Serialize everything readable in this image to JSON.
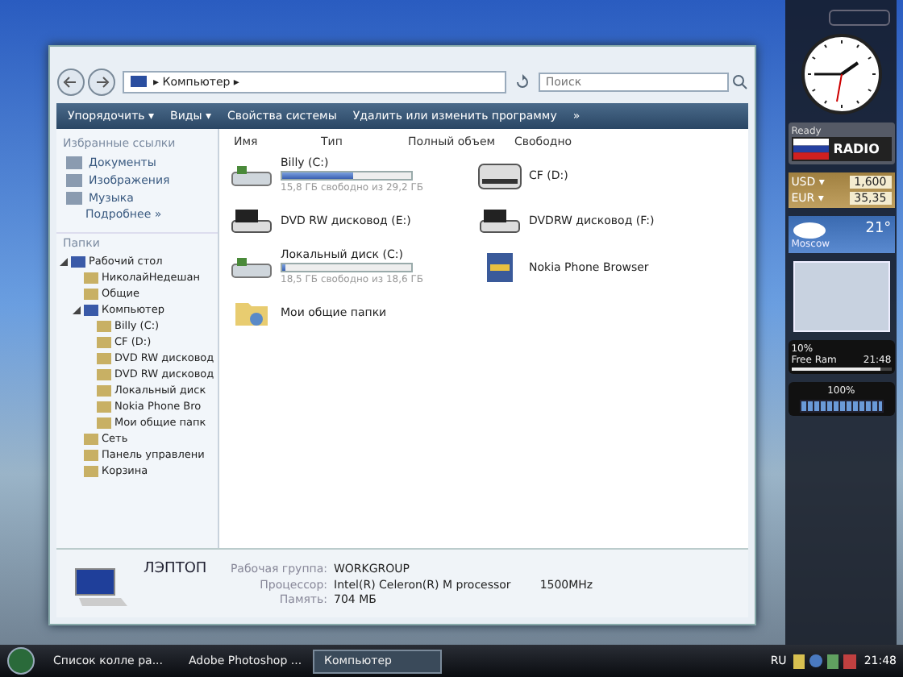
{
  "window": {
    "breadcrumb": "▸ Компьютер ▸",
    "search": {
      "placeholder": "Поиск"
    }
  },
  "toolbar": [
    {
      "label": "Упорядочить ▾"
    },
    {
      "label": "Виды ▾"
    },
    {
      "label": "Свойства системы"
    },
    {
      "label": "Удалить или изменить программу"
    },
    {
      "label": "»"
    }
  ],
  "favorites": {
    "title": "Избранные ссылки",
    "items": [
      "Документы",
      "Изображения",
      "Музыка"
    ],
    "more": "Подробнее »"
  },
  "folders": {
    "title": "Папки",
    "tree": [
      {
        "label": "Рабочий стол",
        "expanded": true,
        "children": [
          {
            "label": "НиколайНедешан"
          },
          {
            "label": "Общие"
          },
          {
            "label": "Компьютер",
            "expanded": true,
            "children": [
              {
                "label": "Billy (C:)"
              },
              {
                "label": "CF (D:)"
              },
              {
                "label": "DVD RW дисковод"
              },
              {
                "label": "DVD RW дисковод"
              },
              {
                "label": "Локальный диск"
              },
              {
                "label": "Nokia Phone Bro"
              },
              {
                "label": "Мои общие папк"
              }
            ]
          },
          {
            "label": "Сеть"
          },
          {
            "label": "Панель управлени"
          },
          {
            "label": "Корзина"
          }
        ]
      }
    ]
  },
  "columns": [
    "Имя",
    "Тип",
    "Полный объем",
    "Свободно"
  ],
  "items": [
    {
      "kind": "disk",
      "name": "Billy (C:)",
      "level": 0.55,
      "free": "15,8 ГБ свободно из 29,2 ГБ"
    },
    {
      "kind": "removable",
      "name": "CF (D:)"
    },
    {
      "kind": "dvd",
      "name": "DVD RW дисковод (E:)"
    },
    {
      "kind": "dvd",
      "name": "DVDRW дисковод (F:)"
    },
    {
      "kind": "disk",
      "name": "Локальный диск (C:)",
      "level": 0.03,
      "free": "18,5 ГБ свободно из 18,6 ГБ"
    },
    {
      "kind": "app",
      "name": "Nokia Phone Browser"
    },
    {
      "kind": "share",
      "name": "Мои общие папки"
    }
  ],
  "details": {
    "computer": "ЛЭПТОП",
    "rows": [
      {
        "label": "Рабочая группа:",
        "value": "WORKGROUP"
      },
      {
        "label": "Процессор:",
        "value": "Intel(R) Celeron(R) M processor",
        "extra": "1500MHz"
      },
      {
        "label": "Память:",
        "value": "704 МБ"
      }
    ]
  },
  "gadgets": {
    "radio": {
      "status": "Ready",
      "logo": "RADIO"
    },
    "currency": [
      {
        "code": "USD ▾",
        "rate": "1,600"
      },
      {
        "code": "EUR ▾",
        "rate": "35,35"
      }
    ],
    "weather": {
      "temp": "21°",
      "city": "Moscow"
    },
    "meter": {
      "cpu": "10%",
      "ram_label": "Free Ram",
      "ram": "21:48",
      "level": 0.9
    },
    "battery": {
      "reading": "100%",
      "level": 1
    }
  },
  "taskbar": {
    "tasks": [
      {
        "label": "Список колле ра...",
        "selected": false
      },
      {
        "label": "Adobe Photoshop ...",
        "selected": false
      },
      {
        "label": "Компьютер",
        "selected": true
      }
    ],
    "lang": "RU",
    "time": "21:48"
  }
}
